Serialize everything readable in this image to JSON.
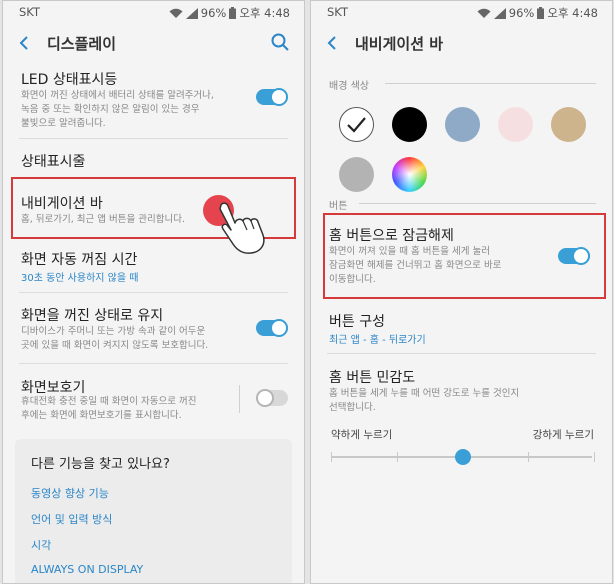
{
  "left": {
    "status": {
      "carrier": "SKT",
      "battery": "96%",
      "time": "오후 4:48"
    },
    "title": "디스플레이",
    "led": {
      "title": "LED 상태표시등",
      "desc": [
        "화면이 꺼진 상태에서 배터리 상태를 알려주거나,",
        "녹음 중 또는 확인하지 않은 알림이 있는 경우",
        "불빛으로 알려줍니다."
      ],
      "toggle": "on"
    },
    "statusbar_item": {
      "title": "상태표시줄"
    },
    "navbar": {
      "title": "내비게이션 바",
      "desc": "홈, 뒤로가기, 최근 앱 버튼을 관리합니다."
    },
    "timeout": {
      "title": "화면 자동 꺼짐 시간",
      "sub": "30초 동안 사용하지 않을 때"
    },
    "keep_off": {
      "title": "화면을 꺼진 상태로 유지",
      "desc": [
        "디바이스가 주머니 또는 가방 속과 같이 어두운",
        "곳에 있을 때 화면이 켜지지 않도록 보호합니다."
      ],
      "toggle": "on"
    },
    "screensaver": {
      "title": "화면보호기",
      "desc": [
        "휴대전화 충전 중일 때 화면이 자동으로 꺼진",
        "후에는 화면에 화면보호기를 표시합니다."
      ],
      "toggle": "off"
    },
    "card": {
      "title": "다른 기능을 찾고 있나요?",
      "links": [
        "동영상 향상 기능",
        "언어 및 입력 방식",
        "시각",
        "ALWAYS ON DISPLAY"
      ]
    },
    "tap_color": "#e5444f"
  },
  "right": {
    "status": {
      "carrier": "SKT",
      "battery": "96%",
      "time": "오후 4:48"
    },
    "title": "내비게이션 바",
    "bg_color_header": "배경 색상",
    "swatches": [
      {
        "color": "#ffffff",
        "selected": true
      },
      {
        "color": "#000000",
        "selected": false
      },
      {
        "color": "#8faac7",
        "selected": false
      },
      {
        "color": "#f6dfe1",
        "selected": false
      },
      {
        "color": "#cdb48c",
        "selected": false
      },
      {
        "color": "#b3b3b3",
        "selected": false
      },
      {
        "color": "rainbow",
        "selected": false
      }
    ],
    "button_header": "버튼",
    "home_unlock": {
      "title": "홈 버튼으로 잠금해제",
      "desc": [
        "화면이 꺼져 있을 때 홈 버튼을 세게 눌러",
        "잠금화면 해제를 건너뛰고 홈 화면으로 바로",
        "이동합니다."
      ],
      "toggle": "on"
    },
    "layout": {
      "title": "버튼 구성",
      "sub": "최근 앱 - 홈 - 뒤로가기"
    },
    "sensitivity": {
      "title": "홈 버튼 민감도",
      "desc": [
        "홈 버튼을 세게 누를 때 어떤 강도로 누를 것인지",
        "선택합니다."
      ]
    },
    "slider": {
      "min_label": "약하게 누르기",
      "max_label": "강하게 누르기",
      "steps": 5,
      "value_index": 2
    },
    "accent": "#3a9fd6",
    "highlight": "#d63a3a"
  }
}
